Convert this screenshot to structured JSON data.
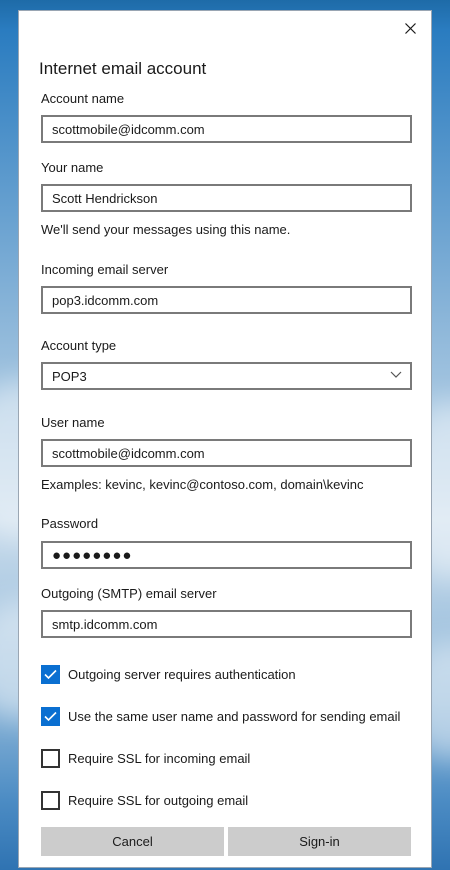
{
  "dialog": {
    "title": "Internet email account"
  },
  "fields": {
    "account_name": {
      "label": "Account name",
      "value": "scottmobile@idcomm.com"
    },
    "your_name": {
      "label": "Your name",
      "value": "Scott Hendrickson",
      "help": "We'll send your messages using this name."
    },
    "incoming_server": {
      "label": "Incoming email server",
      "value": "pop3.idcomm.com"
    },
    "account_type": {
      "label": "Account type",
      "selected": "POP3"
    },
    "user_name": {
      "label": "User name",
      "value": "scottmobile@idcomm.com",
      "help": "Examples: kevinc, kevinc@contoso.com, domain\\kevinc"
    },
    "password": {
      "label": "Password",
      "masked": "●●●●●●●●"
    },
    "outgoing_server": {
      "label": "Outgoing (SMTP) email server",
      "value": "smtp.idcomm.com"
    }
  },
  "checkboxes": [
    {
      "label": "Outgoing server requires authentication",
      "checked": true
    },
    {
      "label": "Use the same user name and password for sending email",
      "checked": true
    },
    {
      "label": "Require SSL for incoming email",
      "checked": false
    },
    {
      "label": "Require SSL for outgoing email",
      "checked": false
    }
  ],
  "buttons": {
    "cancel": "Cancel",
    "sign_in": "Sign-in"
  },
  "colors": {
    "accent": "#0a6fd1",
    "button_bg": "#cccccc",
    "input_border": "#7a7a7a"
  },
  "icons": {
    "close": "close-icon",
    "dropdown": "chevron-down-icon",
    "check": "checkmark-icon"
  }
}
